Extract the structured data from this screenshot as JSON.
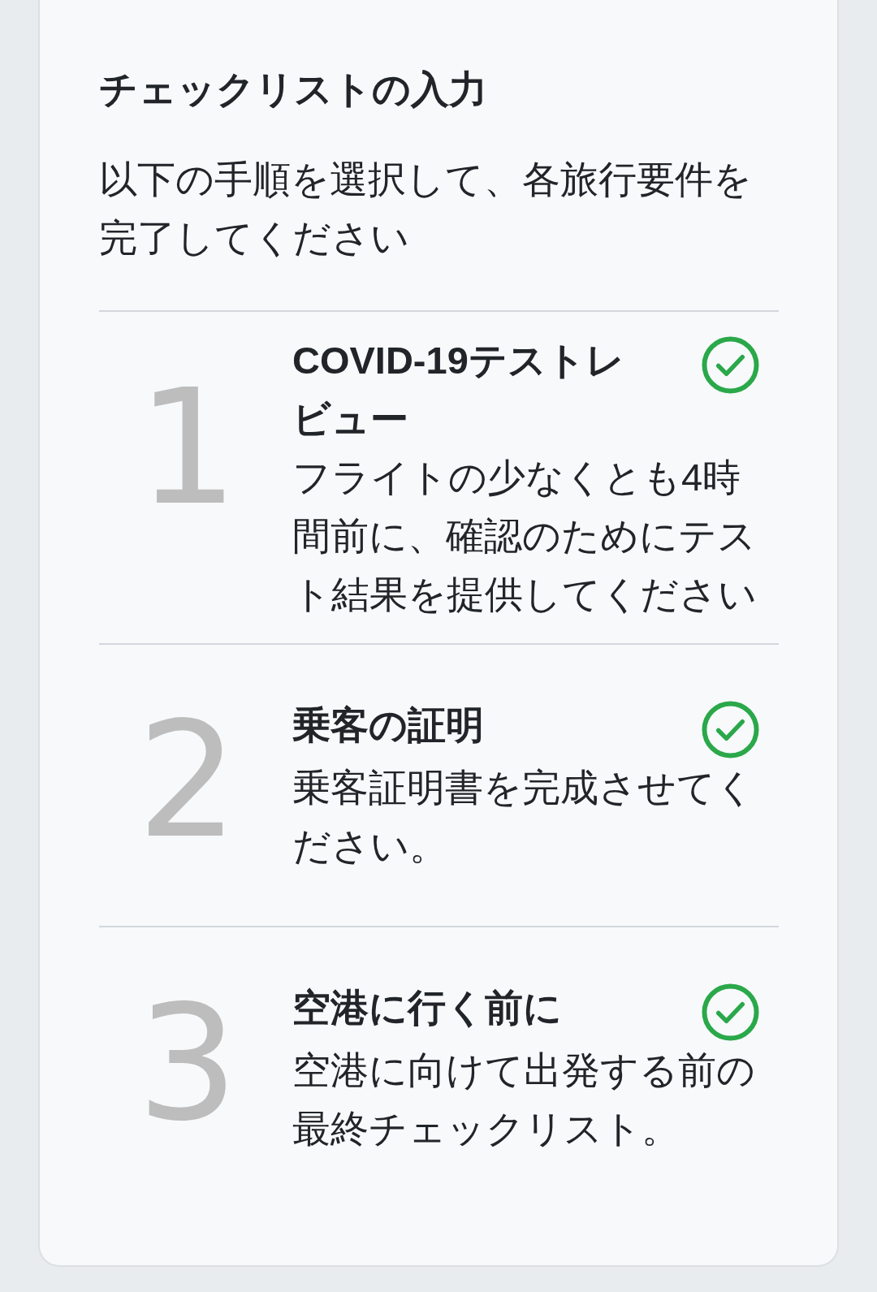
{
  "checklist": {
    "title": "チェックリストの入力",
    "description": "以下の手順を選択して、各旅行要件を完了してください",
    "steps": [
      {
        "number": "1",
        "title": "COVID-19テストレビュー",
        "description": "フライトの少なくとも4時間前に、確認のためにテスト結果を提供してください",
        "completed": true
      },
      {
        "number": "2",
        "title": "乗客の証明",
        "description": "乗客証明書を完成させてください。",
        "completed": true
      },
      {
        "number": "3",
        "title": "空港に行く前に",
        "description": "空港に向けて出発する前の最終チェックリスト。",
        "completed": true
      }
    ]
  }
}
